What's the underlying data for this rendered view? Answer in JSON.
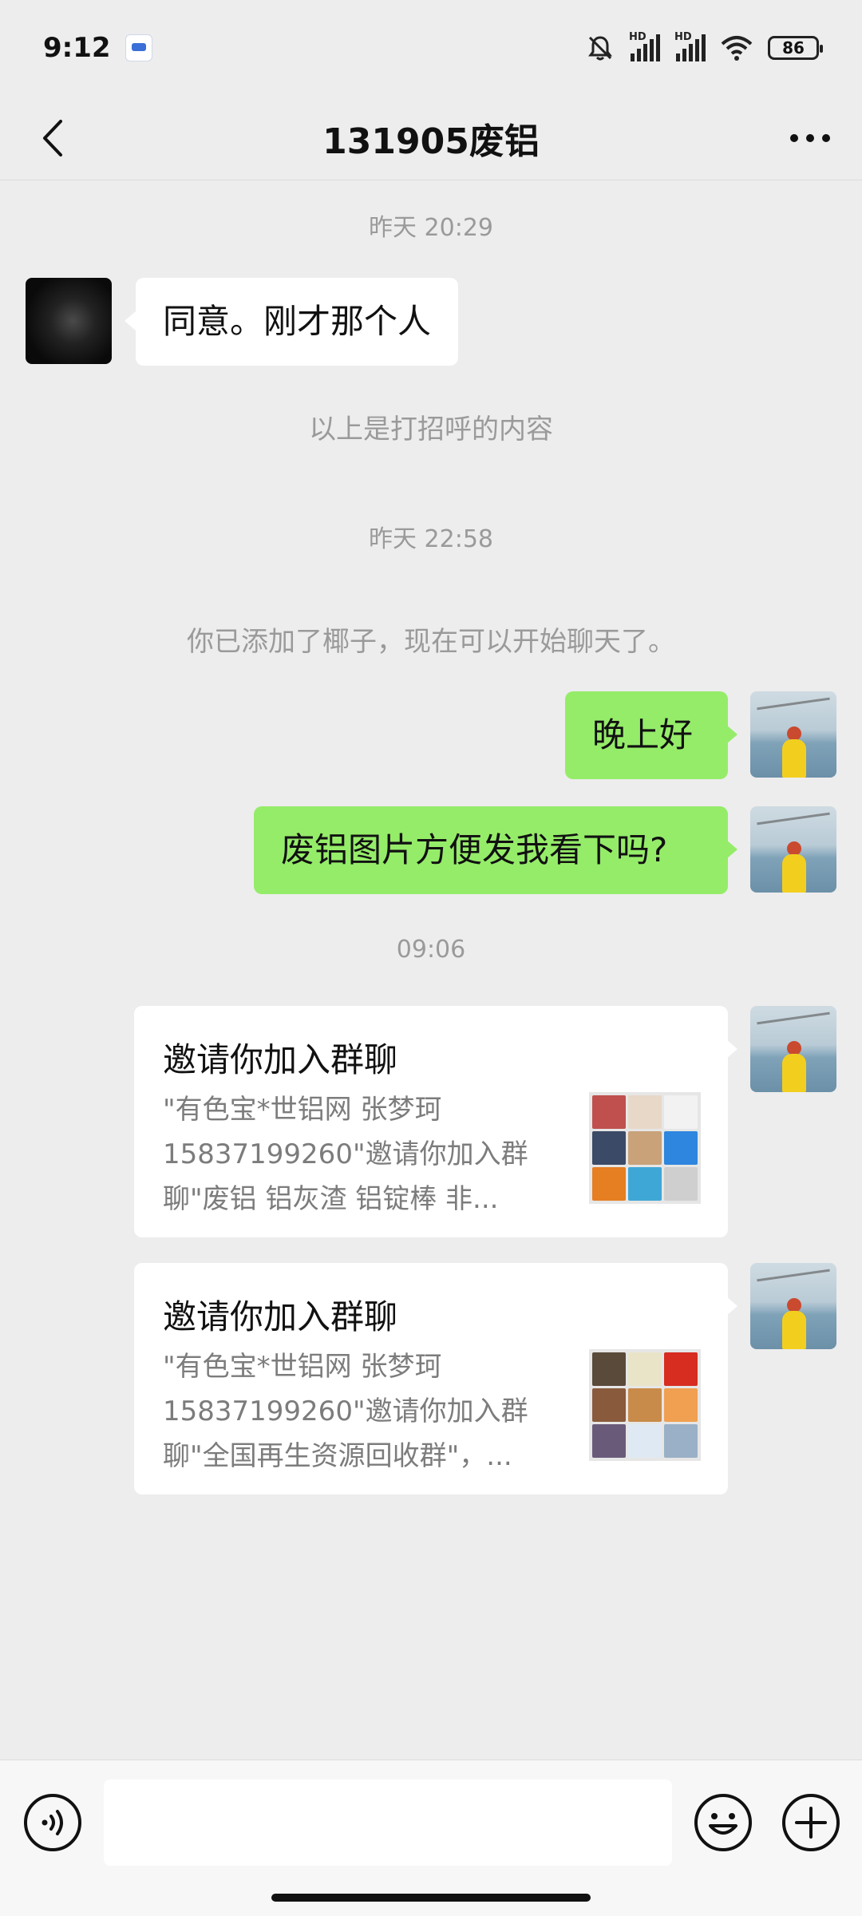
{
  "status_bar": {
    "time": "9:12",
    "signal1_label": "HD",
    "signal2_label": "HD",
    "battery": "86",
    "icons": [
      "app-notification-icon",
      "mute-bell-icon",
      "signal-icon",
      "signal-icon",
      "wifi-icon",
      "battery-icon"
    ]
  },
  "header": {
    "title": "131905废铝",
    "back_icon": "chevron-left-icon",
    "more_icon": "more-dots-icon"
  },
  "messages": {
    "time1": "昨天 20:29",
    "msg1": "同意。刚才那个人",
    "sys1": "以上是打招呼的内容",
    "time2": "昨天 22:58",
    "sys2": "你已添加了椰子，现在可以开始聊天了。",
    "msg2": "晚上好",
    "msg3": "废铝图片方便发我看下吗?",
    "time3": "09:06",
    "card1": {
      "title": "邀请你加入群聊",
      "line1": "\"有色宝*世铝网 张梦珂",
      "line2": "15837199260\"邀请你加入群",
      "line3": "聊\"废铝 铝灰渣 铝锭棒 非..."
    },
    "card2": {
      "title": "邀请你加入群聊",
      "line1": "\"有色宝*世铝网 张梦珂",
      "line2": "15837199260\"邀请你加入群",
      "line3": "聊\"全国再生资源回收群\"，..."
    }
  },
  "input_bar": {
    "voice_icon": "voice-icon",
    "emoji_icon": "emoji-icon",
    "plus_icon": "plus-icon",
    "input_value": ""
  },
  "colors": {
    "background": "#ededed",
    "sent_bubble": "#95ec69",
    "received_bubble": "#ffffff",
    "muted_text": "#9a9a9a"
  }
}
